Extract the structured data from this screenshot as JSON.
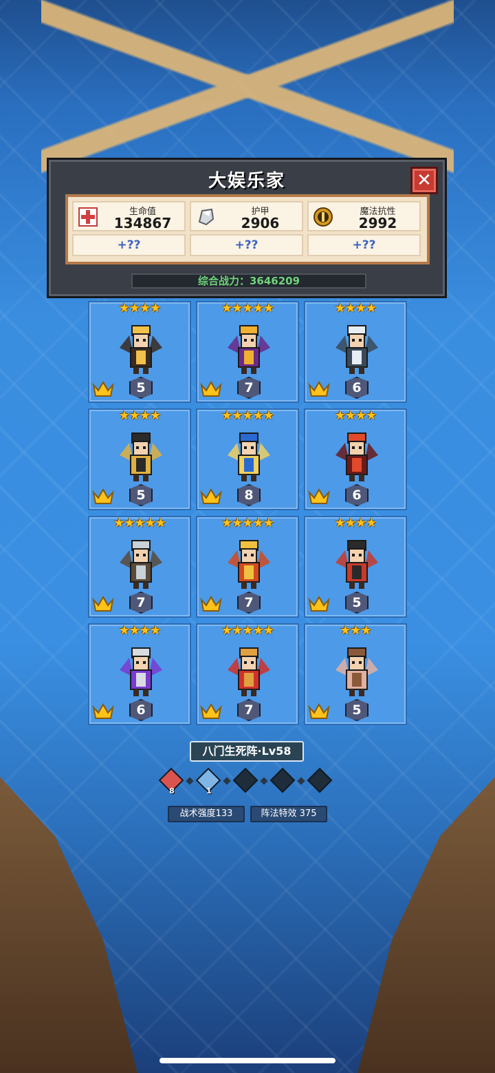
{
  "panel": {
    "title": "大娱乐家",
    "close_label": "✕",
    "stats": [
      {
        "label": "生命值",
        "value": "134867",
        "bonus": "+??",
        "icon": "health-cross-icon"
      },
      {
        "label": "护甲",
        "value": "2906",
        "bonus": "+??",
        "icon": "armor-shard-icon"
      },
      {
        "label": "魔法抗性",
        "value": "2992",
        "bonus": "+??",
        "icon": "magic-resist-icon"
      }
    ],
    "power_text": "综合战力：3646209"
  },
  "heroes": [
    {
      "stars": "★★★★",
      "level": "5"
    },
    {
      "stars": "★★★★★",
      "level": "7"
    },
    {
      "stars": "★★★★",
      "level": "6"
    },
    {
      "stars": "★★★★",
      "level": "5"
    },
    {
      "stars": "★★★★★",
      "level": "8"
    },
    {
      "stars": "★★★★",
      "level": "6"
    },
    {
      "stars": "★★★★★",
      "level": "7"
    },
    {
      "stars": "★★★★★",
      "level": "7"
    },
    {
      "stars": "★★★★",
      "level": "5"
    },
    {
      "stars": "★★★★",
      "level": "6"
    },
    {
      "stars": "★★★★★",
      "level": "7"
    },
    {
      "stars": "★★★",
      "level": "5"
    }
  ],
  "formation": {
    "name": "八门生死阵·Lv58",
    "gems": [
      {
        "color": "#d9534f",
        "count": "8"
      },
      {
        "color": "#7fb6e6",
        "count": "1"
      },
      {
        "color": "#1f2d3a",
        "count": ""
      },
      {
        "color": "#1f2d3a",
        "count": ""
      },
      {
        "color": "#1f2d3a",
        "count": ""
      }
    ],
    "tactics_label": "战术强度133",
    "effect_label": "阵法特效 375"
  }
}
